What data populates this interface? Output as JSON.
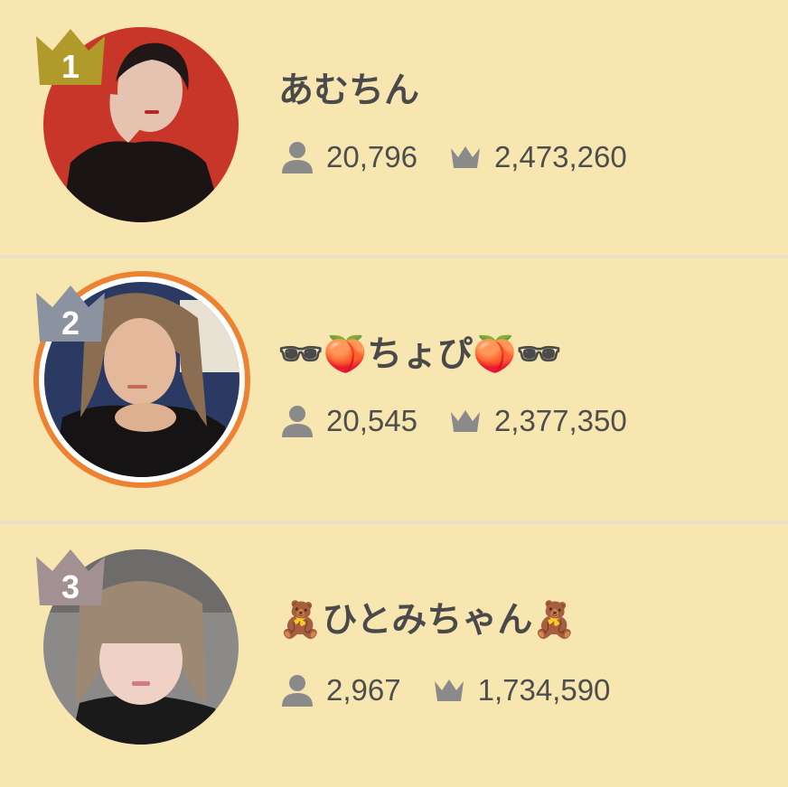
{
  "ranking": [
    {
      "rank": "1",
      "name": "あむちん",
      "followers": "20,796",
      "points": "2,473,260",
      "crown_color": "#B09A2A",
      "avatar_ring": null
    },
    {
      "rank": "2",
      "name": "🕶🍑ちょぴ🍑🕶",
      "followers": "20,545",
      "points": "2,377,350",
      "crown_color": "#8C93A0",
      "avatar_ring": "#EE8233"
    },
    {
      "rank": "3",
      "name": "🧸ひとみちゃん🧸",
      "followers": "2,967",
      "points": "1,734,590",
      "crown_color": "#A39092",
      "avatar_ring": null
    }
  ],
  "icons": {
    "followers": "person-icon",
    "points": "crown-icon"
  },
  "colors": {
    "background": "#F8E6B0",
    "divider": "#ECE0C4",
    "text": "#4A4A4A",
    "icon_gray": "#8A8A8A"
  }
}
